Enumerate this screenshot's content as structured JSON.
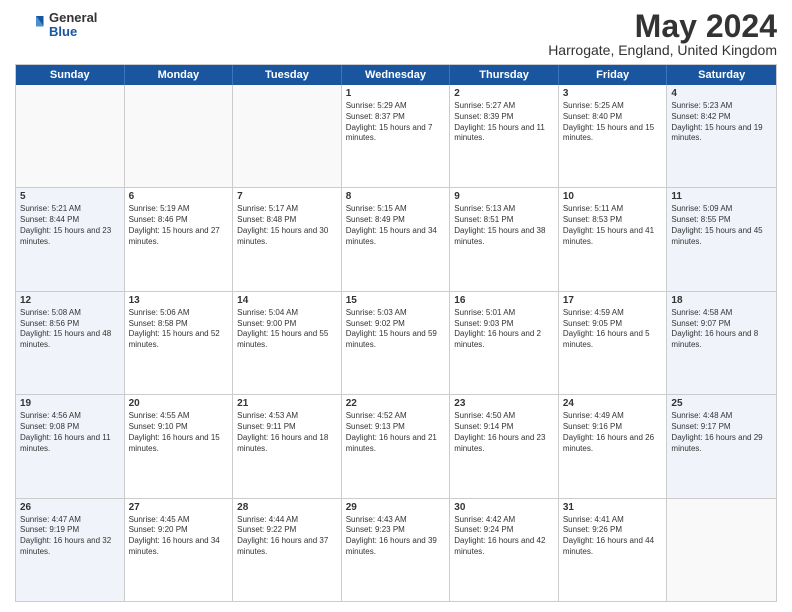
{
  "header": {
    "logo": {
      "general": "General",
      "blue": "Blue"
    },
    "title": "May 2024",
    "location": "Harrogate, England, United Kingdom"
  },
  "days_of_week": [
    "Sunday",
    "Monday",
    "Tuesday",
    "Wednesday",
    "Thursday",
    "Friday",
    "Saturday"
  ],
  "weeks": [
    {
      "cells": [
        {
          "day": null,
          "sunrise": null,
          "sunset": null,
          "daylight": null
        },
        {
          "day": null,
          "sunrise": null,
          "sunset": null,
          "daylight": null
        },
        {
          "day": null,
          "sunrise": null,
          "sunset": null,
          "daylight": null
        },
        {
          "day": "1",
          "sunrise": "Sunrise: 5:29 AM",
          "sunset": "Sunset: 8:37 PM",
          "daylight": "Daylight: 15 hours and 7 minutes."
        },
        {
          "day": "2",
          "sunrise": "Sunrise: 5:27 AM",
          "sunset": "Sunset: 8:39 PM",
          "daylight": "Daylight: 15 hours and 11 minutes."
        },
        {
          "day": "3",
          "sunrise": "Sunrise: 5:25 AM",
          "sunset": "Sunset: 8:40 PM",
          "daylight": "Daylight: 15 hours and 15 minutes."
        },
        {
          "day": "4",
          "sunrise": "Sunrise: 5:23 AM",
          "sunset": "Sunset: 8:42 PM",
          "daylight": "Daylight: 15 hours and 19 minutes."
        }
      ]
    },
    {
      "cells": [
        {
          "day": "5",
          "sunrise": "Sunrise: 5:21 AM",
          "sunset": "Sunset: 8:44 PM",
          "daylight": "Daylight: 15 hours and 23 minutes."
        },
        {
          "day": "6",
          "sunrise": "Sunrise: 5:19 AM",
          "sunset": "Sunset: 8:46 PM",
          "daylight": "Daylight: 15 hours and 27 minutes."
        },
        {
          "day": "7",
          "sunrise": "Sunrise: 5:17 AM",
          "sunset": "Sunset: 8:48 PM",
          "daylight": "Daylight: 15 hours and 30 minutes."
        },
        {
          "day": "8",
          "sunrise": "Sunrise: 5:15 AM",
          "sunset": "Sunset: 8:49 PM",
          "daylight": "Daylight: 15 hours and 34 minutes."
        },
        {
          "day": "9",
          "sunrise": "Sunrise: 5:13 AM",
          "sunset": "Sunset: 8:51 PM",
          "daylight": "Daylight: 15 hours and 38 minutes."
        },
        {
          "day": "10",
          "sunrise": "Sunrise: 5:11 AM",
          "sunset": "Sunset: 8:53 PM",
          "daylight": "Daylight: 15 hours and 41 minutes."
        },
        {
          "day": "11",
          "sunrise": "Sunrise: 5:09 AM",
          "sunset": "Sunset: 8:55 PM",
          "daylight": "Daylight: 15 hours and 45 minutes."
        }
      ]
    },
    {
      "cells": [
        {
          "day": "12",
          "sunrise": "Sunrise: 5:08 AM",
          "sunset": "Sunset: 8:56 PM",
          "daylight": "Daylight: 15 hours and 48 minutes."
        },
        {
          "day": "13",
          "sunrise": "Sunrise: 5:06 AM",
          "sunset": "Sunset: 8:58 PM",
          "daylight": "Daylight: 15 hours and 52 minutes."
        },
        {
          "day": "14",
          "sunrise": "Sunrise: 5:04 AM",
          "sunset": "Sunset: 9:00 PM",
          "daylight": "Daylight: 15 hours and 55 minutes."
        },
        {
          "day": "15",
          "sunrise": "Sunrise: 5:03 AM",
          "sunset": "Sunset: 9:02 PM",
          "daylight": "Daylight: 15 hours and 59 minutes."
        },
        {
          "day": "16",
          "sunrise": "Sunrise: 5:01 AM",
          "sunset": "Sunset: 9:03 PM",
          "daylight": "Daylight: 16 hours and 2 minutes."
        },
        {
          "day": "17",
          "sunrise": "Sunrise: 4:59 AM",
          "sunset": "Sunset: 9:05 PM",
          "daylight": "Daylight: 16 hours and 5 minutes."
        },
        {
          "day": "18",
          "sunrise": "Sunrise: 4:58 AM",
          "sunset": "Sunset: 9:07 PM",
          "daylight": "Daylight: 16 hours and 8 minutes."
        }
      ]
    },
    {
      "cells": [
        {
          "day": "19",
          "sunrise": "Sunrise: 4:56 AM",
          "sunset": "Sunset: 9:08 PM",
          "daylight": "Daylight: 16 hours and 11 minutes."
        },
        {
          "day": "20",
          "sunrise": "Sunrise: 4:55 AM",
          "sunset": "Sunset: 9:10 PM",
          "daylight": "Daylight: 16 hours and 15 minutes."
        },
        {
          "day": "21",
          "sunrise": "Sunrise: 4:53 AM",
          "sunset": "Sunset: 9:11 PM",
          "daylight": "Daylight: 16 hours and 18 minutes."
        },
        {
          "day": "22",
          "sunrise": "Sunrise: 4:52 AM",
          "sunset": "Sunset: 9:13 PM",
          "daylight": "Daylight: 16 hours and 21 minutes."
        },
        {
          "day": "23",
          "sunrise": "Sunrise: 4:50 AM",
          "sunset": "Sunset: 9:14 PM",
          "daylight": "Daylight: 16 hours and 23 minutes."
        },
        {
          "day": "24",
          "sunrise": "Sunrise: 4:49 AM",
          "sunset": "Sunset: 9:16 PM",
          "daylight": "Daylight: 16 hours and 26 minutes."
        },
        {
          "day": "25",
          "sunrise": "Sunrise: 4:48 AM",
          "sunset": "Sunset: 9:17 PM",
          "daylight": "Daylight: 16 hours and 29 minutes."
        }
      ]
    },
    {
      "cells": [
        {
          "day": "26",
          "sunrise": "Sunrise: 4:47 AM",
          "sunset": "Sunset: 9:19 PM",
          "daylight": "Daylight: 16 hours and 32 minutes."
        },
        {
          "day": "27",
          "sunrise": "Sunrise: 4:45 AM",
          "sunset": "Sunset: 9:20 PM",
          "daylight": "Daylight: 16 hours and 34 minutes."
        },
        {
          "day": "28",
          "sunrise": "Sunrise: 4:44 AM",
          "sunset": "Sunset: 9:22 PM",
          "daylight": "Daylight: 16 hours and 37 minutes."
        },
        {
          "day": "29",
          "sunrise": "Sunrise: 4:43 AM",
          "sunset": "Sunset: 9:23 PM",
          "daylight": "Daylight: 16 hours and 39 minutes."
        },
        {
          "day": "30",
          "sunrise": "Sunrise: 4:42 AM",
          "sunset": "Sunset: 9:24 PM",
          "daylight": "Daylight: 16 hours and 42 minutes."
        },
        {
          "day": "31",
          "sunrise": "Sunrise: 4:41 AM",
          "sunset": "Sunset: 9:26 PM",
          "daylight": "Daylight: 16 hours and 44 minutes."
        },
        {
          "day": null,
          "sunrise": null,
          "sunset": null,
          "daylight": null
        }
      ]
    }
  ]
}
